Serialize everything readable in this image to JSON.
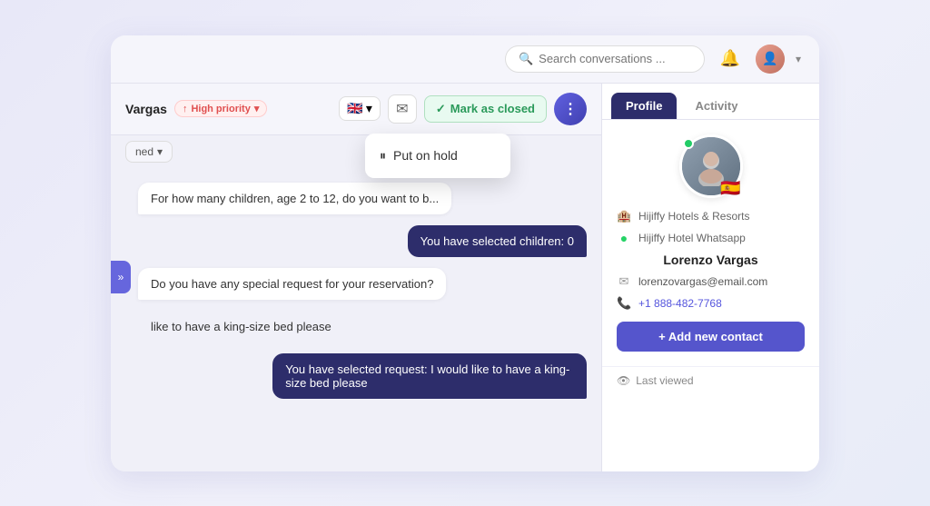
{
  "header": {
    "search_placeholder": "Search conversations ...",
    "bell_label": "notifications",
    "chevron_label": "expand menu"
  },
  "conversation": {
    "contact_name": "Vargas",
    "priority_label": "High priority",
    "flag_emoji": "🇬🇧",
    "status_options": [
      "Opened"
    ],
    "current_status": "ned",
    "mark_closed_label": "Mark as closed",
    "more_options_icon": "⋮",
    "collapse_icon": "»"
  },
  "dropdown": {
    "items": [
      {
        "label": "Put on hold",
        "icon": "⏸"
      }
    ]
  },
  "messages": [
    {
      "type": "bot",
      "text": "For how many children, age 2 to 12, do you want to b..."
    },
    {
      "type": "selected",
      "text": "You have selected children: 0"
    },
    {
      "type": "bot",
      "text": "Do you have any special request for your reservation?"
    },
    {
      "type": "user",
      "text": "like to have a king-size bed please"
    },
    {
      "type": "selected",
      "text": "You have selected request: I would like to have a king-size bed please"
    }
  ],
  "profile": {
    "tabs": [
      {
        "label": "Profile",
        "active": true
      },
      {
        "label": "Activity",
        "active": false
      }
    ],
    "company": "Hijiffy Hotels & Resorts",
    "channel": "Hijiffy Hotel Whatsapp",
    "name": "Lorenzo Vargas",
    "email": "lorenzovargas@email.com",
    "phone": "+1 888-482-7768",
    "flag_emoji": "🇪🇸",
    "add_contact_label": "+ Add new contact",
    "last_viewed_label": "Last viewed"
  }
}
